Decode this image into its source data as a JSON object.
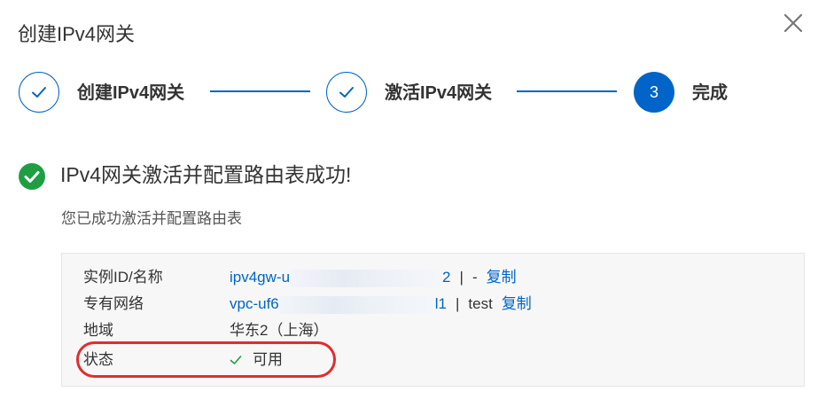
{
  "dialog": {
    "title": "创建IPv4网关"
  },
  "steps": [
    {
      "label": "创建IPv4网关",
      "state": "done"
    },
    {
      "label": "激活IPv4网关",
      "state": "done"
    },
    {
      "label": "完成",
      "state": "current",
      "number": "3"
    }
  ],
  "result": {
    "title": "IPv4网关激活并配置路由表成功!",
    "description": "您已成功激活并配置路由表"
  },
  "info": {
    "instance": {
      "key": "实例ID/名称",
      "id_prefix": "ipv4gw-u",
      "id_suffix": "2",
      "separator": "|",
      "name": "-",
      "copy_label": "复制"
    },
    "vpc": {
      "key": "专有网络",
      "id_prefix": "vpc-uf6",
      "id_suffix": "l1",
      "separator": "|",
      "name": "test",
      "copy_label": "复制"
    },
    "region": {
      "key": "地域",
      "value": "华东2（上海）"
    },
    "status": {
      "key": "状态",
      "value": "可用"
    }
  },
  "colors": {
    "primary": "#0064c8",
    "success": "#1e9e43",
    "highlight": "#e02d2d",
    "box_bg": "#f7f7f7"
  },
  "icons": {
    "close": "close-icon",
    "step_done": "check-icon",
    "success": "success-check-circle-icon",
    "status_ok": "check-icon"
  }
}
